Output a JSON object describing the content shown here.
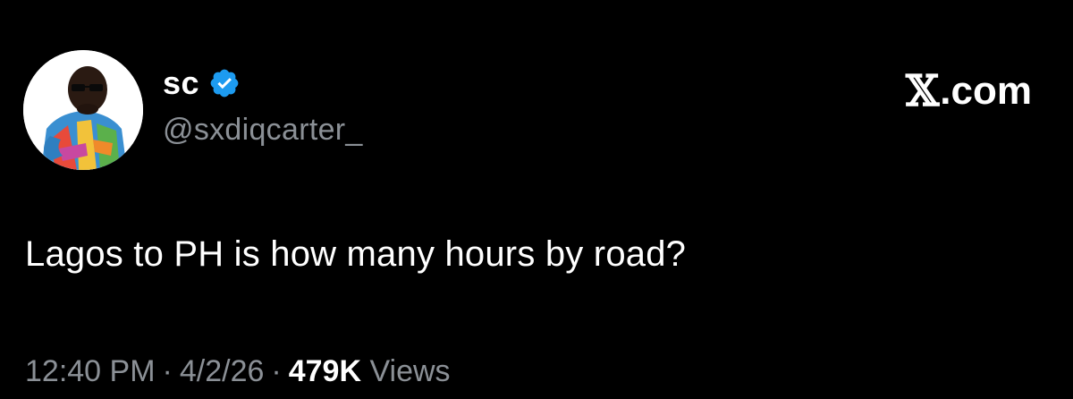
{
  "author": {
    "display_name": "sc",
    "handle": "@sxdiqcarter_",
    "verified": true,
    "verified_color": "#1d9bf0",
    "avatar_icon": "profile-photo"
  },
  "brand": {
    "x_glyph": "𝕏",
    "domain": ".com"
  },
  "tweet": {
    "text": "Lagos to PH is how many hours by road?"
  },
  "meta": {
    "time": "12:40 PM",
    "date": "4/2/26",
    "separator": "·",
    "views_count": "479K",
    "views_label": "Views"
  },
  "colors": {
    "background": "#000000",
    "text_primary": "#ffffff",
    "text_secondary": "#8b9096"
  }
}
